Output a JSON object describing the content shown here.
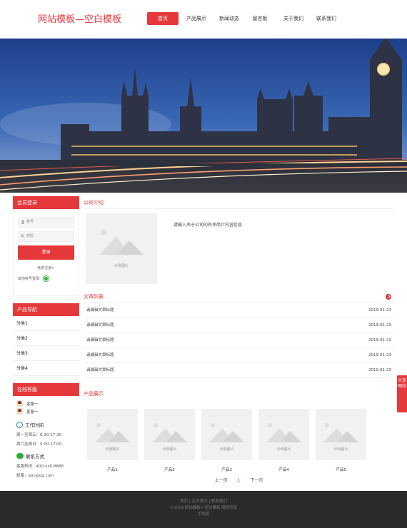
{
  "header": {
    "logo": "网站模板—空白模板",
    "nav": [
      "首页",
      "产品展示",
      "新闻动态",
      "留言板",
      "关于我们",
      "联系我们"
    ]
  },
  "sidebar": {
    "login_title": "会员登录",
    "account_placeholder": "帐号",
    "password_placeholder": "密码",
    "login_button": "登录",
    "register_link": "免费注册>",
    "other_login": "其他帐号登录:",
    "product_nav_title": "产品导航",
    "categories": [
      "分类1",
      "分类2",
      "分类3",
      "分类4"
    ],
    "service_title": "在线客服",
    "services": [
      "客服一",
      "客服一"
    ],
    "work_time_title": "工作时间",
    "work_time": [
      "周一至周五：8:30-17:30",
      "周六至周日：9:00-17:00"
    ],
    "contact_title": "联系方式",
    "phone": "客服热线：400-xx6-8888",
    "email": "邮箱：abc@qq.com"
  },
  "main": {
    "about_title": "公司介绍",
    "about_text": "请输入关于公司的有关简介内容信息",
    "sample_image": "示例图片",
    "articles_title": "文章列表",
    "articles": [
      {
        "title": "请编辑文章标题",
        "date": "2019-01-23"
      },
      {
        "title": "请编辑文章标题",
        "date": "2019-01-23"
      },
      {
        "title": "请编辑文章标题",
        "date": "2019-01-23"
      },
      {
        "title": "请编辑文章标题",
        "date": "2019-01-23"
      },
      {
        "title": "请编辑文章标题",
        "date": "2019-01-23"
      }
    ],
    "products_title": "产品展示",
    "products": [
      "产品1",
      "产品2",
      "产品3",
      "产品4",
      "产品5"
    ],
    "pager": {
      "prev": "上一页",
      "current": "1",
      "next": "下一页"
    }
  },
  "footer": {
    "links": "首页 | 关于我们 | 联系我们",
    "copyright": "©2019 网站模板—空白模板 版权所有",
    "mobile": "手机版"
  },
  "share": "分享网站",
  "colors": {
    "accent": "#e5383b",
    "footer_bg": "#2b2b2b"
  }
}
